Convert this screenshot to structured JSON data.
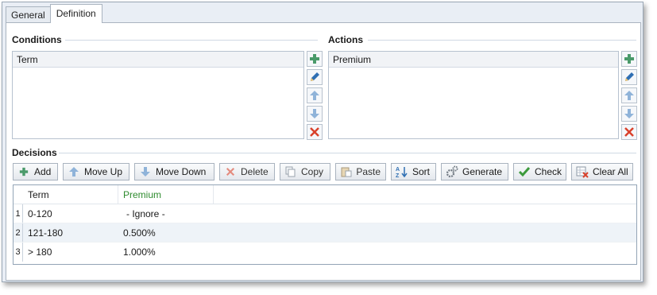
{
  "tabs": [
    {
      "label": "General",
      "active": false
    },
    {
      "label": "Definition",
      "active": true
    }
  ],
  "conditions": {
    "title": "Conditions",
    "header": "Term",
    "buttons": [
      "add-icon",
      "edit-icon",
      "move-up-icon",
      "move-down-icon",
      "delete-icon"
    ]
  },
  "actions": {
    "title": "Actions",
    "header": "Premium",
    "buttons": [
      "add-icon",
      "edit-icon",
      "move-up-icon",
      "move-down-icon",
      "delete-icon"
    ]
  },
  "decisions": {
    "title": "Decisions",
    "toolbar": {
      "add": "Add",
      "move_up": "Move Up",
      "move_down": "Move Down",
      "delete": "Delete",
      "copy": "Copy",
      "paste": "Paste",
      "sort": "Sort",
      "generate": "Generate",
      "check": "Check",
      "clear_all": "Clear All"
    },
    "columns": [
      "Term",
      "Premium"
    ],
    "rows": [
      {
        "num": "1",
        "term": "0-120",
        "premium": "- Ignore -"
      },
      {
        "num": "2",
        "term": "121-180",
        "premium": "0.500%"
      },
      {
        "num": "3",
        "term": "> 180",
        "premium": "1.000%"
      }
    ]
  },
  "colors": {
    "premium_header": "#2e8b2e",
    "add_green": "#4a9a6a",
    "edit_blue": "#2f6fb3",
    "arrow_blue": "#8fb3d9",
    "delete_red": "#d9412b"
  }
}
